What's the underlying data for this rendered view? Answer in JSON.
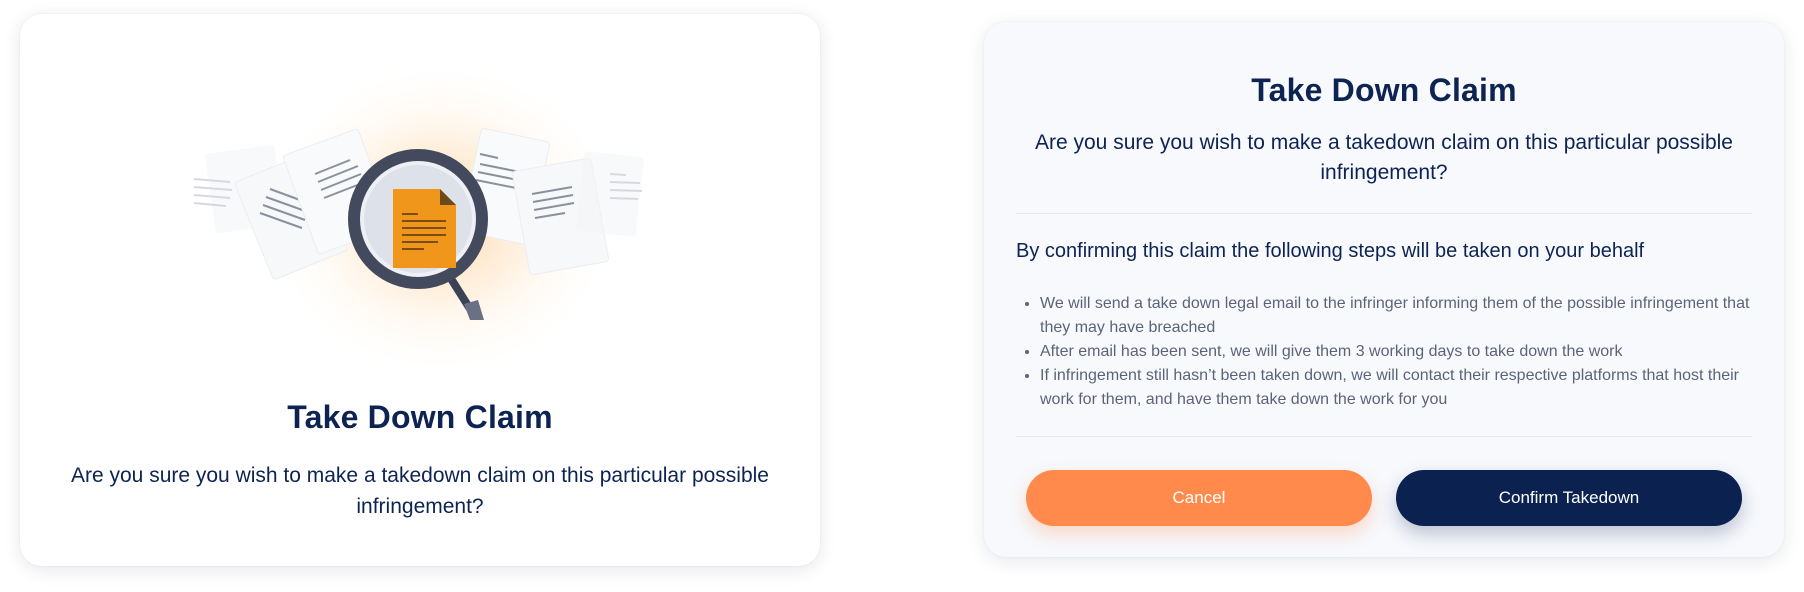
{
  "left_card": {
    "title": "Take Down Claim",
    "subtitle": "Are you sure you wish to make a takedown claim on this particular possible infringement?"
  },
  "right_card": {
    "title": "Take Down Claim",
    "subtitle": "Are you sure you wish to make a takedown claim on this particular possible infringement?",
    "steps_heading": "By confirming this claim the following steps will be taken on your behalf",
    "steps": [
      "We will send a take down legal email to the infringer informing them of the possible infringement that they may have breached",
      "After email has been sent, we will give them 3 working days to take down the work",
      "If infringement still hasn’t been taken down, we will contact their respective platforms that host their work for them, and have them take down the work for you"
    ],
    "cancel_label": "Cancel",
    "confirm_label": "Confirm Takedown"
  },
  "colors": {
    "navy": "#0d2352",
    "orange": "#ff8a4c",
    "confirm_bg": "#0b2150",
    "document_orange": "#f0961a"
  },
  "illustration": {
    "icon": "magnifying-glass-document-icon"
  }
}
